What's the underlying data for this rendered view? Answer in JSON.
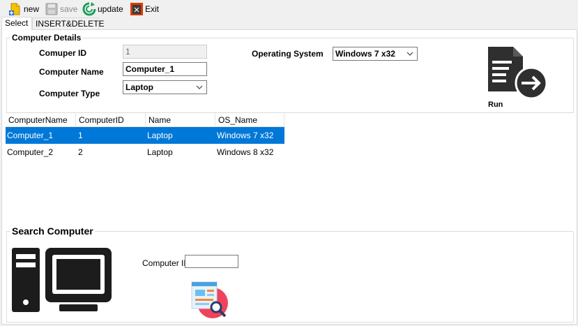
{
  "toolbar": {
    "new_label": "new",
    "save_label": "save",
    "update_label": "update",
    "exit_label": "Exit"
  },
  "tabs": [
    {
      "label": "Select",
      "active": true
    },
    {
      "label": "INSERT&DELETE",
      "active": false
    }
  ],
  "computer_details": {
    "title": "Computer Details",
    "id_label": "Comuper ID",
    "id_value": "1",
    "name_label": "Computer Name",
    "name_value": "Computer_1",
    "type_label": "Computer Type",
    "type_value": "Laptop",
    "os_label": "Operating System",
    "os_value": "Windows 7 x32",
    "run_label": "Run"
  },
  "grid": {
    "headers": [
      "ComputerName",
      "ComputerID",
      "Name",
      "OS_Name"
    ],
    "rows": [
      {
        "ComputerName": "Computer_1",
        "ComputerID": "1",
        "Name": "Laptop",
        "OS_Name": "Windows 7 x32",
        "selected": true
      },
      {
        "ComputerName": "Computer_2",
        "ComputerID": "2",
        "Name": "Laptop",
        "OS_Name": "Windows 8 x32",
        "selected": false
      }
    ]
  },
  "search": {
    "title": "Search Computer",
    "id_label": "Computer ID",
    "id_value": ""
  },
  "colors": {
    "selection": "#0078d7",
    "accent_green": "#1e9e5a",
    "exit_red": "#d83b01"
  }
}
